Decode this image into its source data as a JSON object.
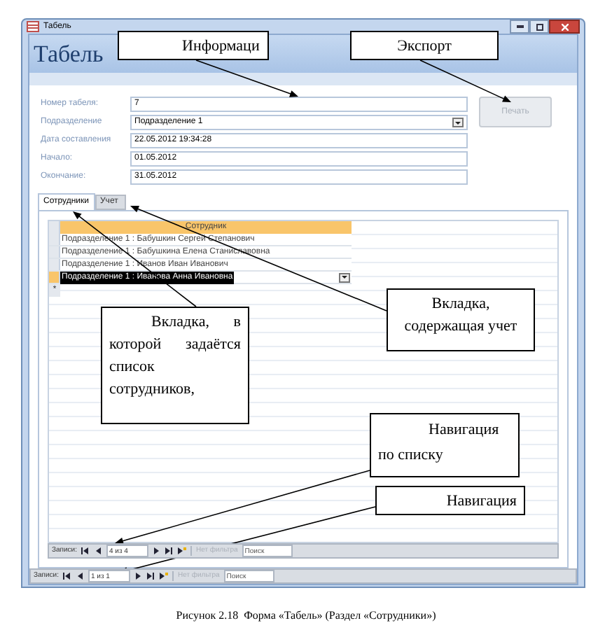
{
  "window": {
    "title": "Табель",
    "header": "Табель"
  },
  "fields": [
    {
      "label": "Номер табеля:",
      "value": "7",
      "kind": "text"
    },
    {
      "label": "Подразделение",
      "value": "Подразделение 1",
      "kind": "combo"
    },
    {
      "label": "Дата составления",
      "value": "22.05.2012 19:34:28",
      "kind": "text"
    },
    {
      "label": "Начало:",
      "value": "01.05.2012",
      "kind": "text"
    },
    {
      "label": "Окончание:",
      "value": "31.05.2012",
      "kind": "text"
    }
  ],
  "print_button": {
    "label": "Печать",
    "disabled": true
  },
  "tabs": [
    {
      "label": "Сотрудники",
      "selected": true
    },
    {
      "label": "Учет",
      "selected": false
    }
  ],
  "datasheet": {
    "column": "Сотрудник",
    "rows": [
      {
        "text": "Подразделение 1 : Бабушкин Сергей Степанович",
        "selected": false
      },
      {
        "text": "Подразделение 1 : Бабушкина Елена Станиславовна",
        "selected": false
      },
      {
        "text": "Подразделение 1 : Иванов Иван Иванович",
        "selected": false
      },
      {
        "text": "Подразделение 1 : Иванова Анна Ивановна",
        "selected": true
      }
    ],
    "new_row_marker": "*"
  },
  "subform_nav": {
    "label": "Записи:",
    "position": "4 из 4",
    "filter": "Нет фильтра",
    "search_placeholder": "Поиск"
  },
  "form_nav": {
    "label": "Записи:",
    "position": "1 из 1",
    "filter": "Нет фильтра",
    "search_placeholder": "Поиск"
  },
  "callouts": [
    {
      "text": "Информаци"
    },
    {
      "text": "Экспорт"
    },
    {
      "text": "Вкладка, в которой задаётся список сотрудников,"
    },
    {
      "text": "Вкладка, содержащая учет"
    },
    {
      "text": "Навигация по списку"
    },
    {
      "text": "Навигация"
    }
  ],
  "caption": "Рисунок 2.18  Форма «Табель» (Раздел «Сотрудники»)"
}
